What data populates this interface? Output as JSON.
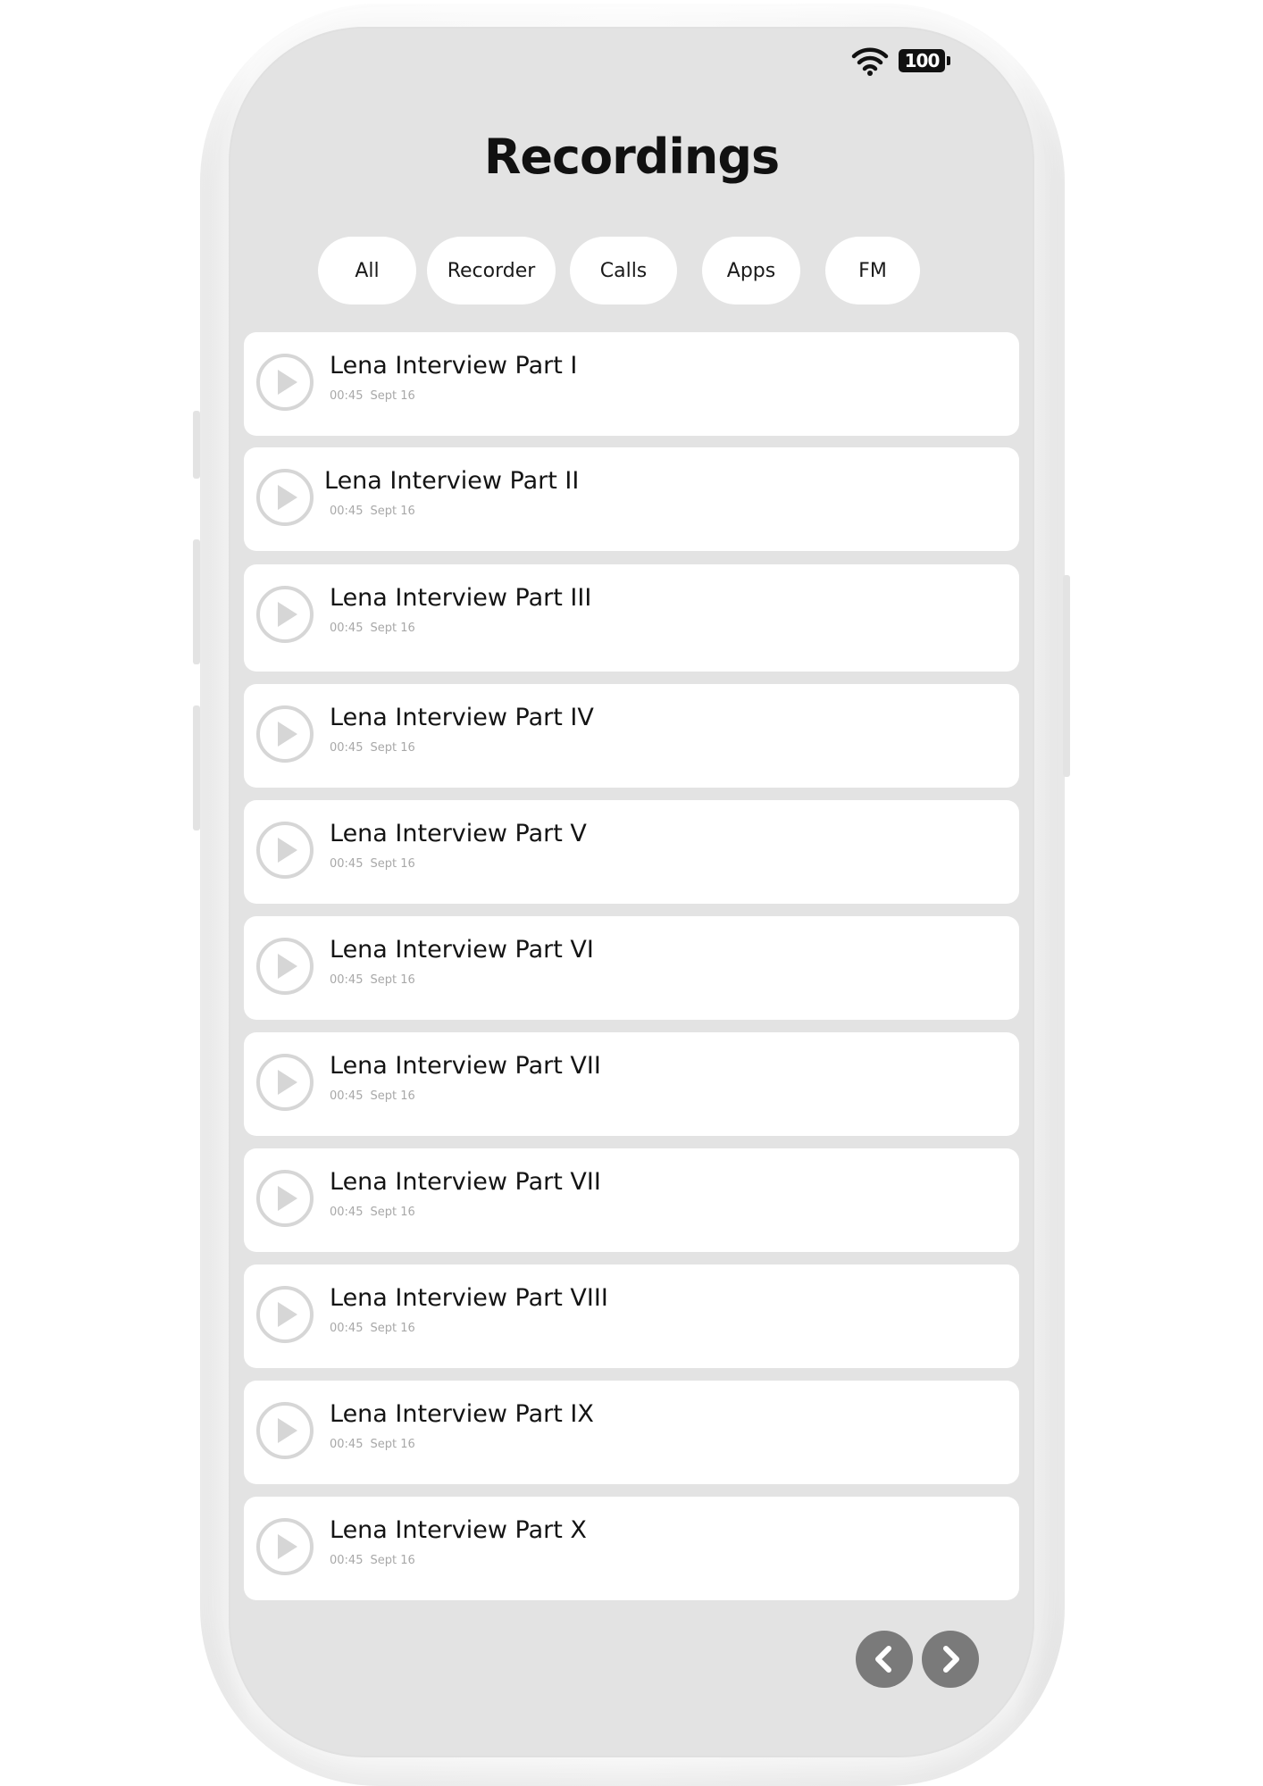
{
  "app": {
    "title": "Recordings"
  },
  "status_bar": {
    "wifi_icon": "wifi-icon",
    "battery_level": "100"
  },
  "filters": [
    {
      "label": "All"
    },
    {
      "label": "Recorder"
    },
    {
      "label": "Calls"
    },
    {
      "label": "Apps"
    },
    {
      "label": "FM"
    }
  ],
  "recordings": [
    {
      "title": "Lena Interview Part I",
      "duration": "00:45",
      "date": "Sept 16"
    },
    {
      "title": "Lena Interview Part II",
      "duration": "00:45",
      "date": "Sept 16"
    },
    {
      "title": "Lena Interview Part III",
      "duration": "00:45",
      "date": "Sept 16"
    },
    {
      "title": "Lena Interview Part IV",
      "duration": "00:45",
      "date": "Sept 16"
    },
    {
      "title": "Lena Interview Part V",
      "duration": "00:45",
      "date": "Sept 16"
    },
    {
      "title": "Lena Interview Part VI",
      "duration": "00:45",
      "date": "Sept 16"
    },
    {
      "title": "Lena Interview Part VII",
      "duration": "00:45",
      "date": "Sept 16"
    },
    {
      "title": "Lena Interview Part VII",
      "duration": "00:45",
      "date": "Sept 16"
    },
    {
      "title": "Lena Interview Part VIII",
      "duration": "00:45",
      "date": "Sept 16"
    },
    {
      "title": "Lena Interview Part IX",
      "duration": "00:45",
      "date": "Sept 16"
    },
    {
      "title": "Lena Interview Part X",
      "duration": "00:45",
      "date": "Sept 16"
    }
  ],
  "pagination": {
    "prev_icon": "chevron-left-icon",
    "next_icon": "chevron-right-icon"
  },
  "colors": {
    "screen_bg": "#e3e3e3",
    "card_bg": "#ffffff",
    "play_ring": "#d6d6d6",
    "nav_button": "#7a7a7a",
    "text_primary": "#141414",
    "text_secondary": "#a8a8a8"
  }
}
